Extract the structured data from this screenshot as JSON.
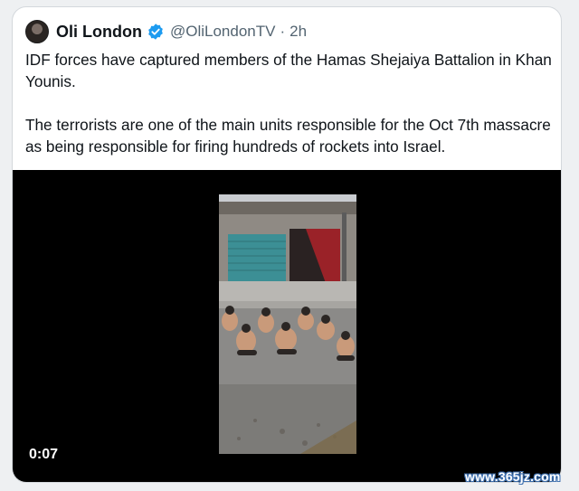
{
  "post": {
    "author_name": "Oli London",
    "handle": "@OliLondonTV",
    "separator": "·",
    "time": "2h",
    "paragraphs": [
      "IDF forces have captured members of the Hamas Shejaiya Battalion in Khan Younis.",
      "The terrorists are one of the main units responsible for the Oct 7th massacre as being responsible for firing hundreds of rockets into Israel."
    ],
    "verified_icon": "verified-badge-icon"
  },
  "video": {
    "duration": "0:07"
  },
  "watermark": "www.365jz.com",
  "colors": {
    "text_primary": "#0f1419",
    "text_secondary": "#536471",
    "verified_blue": "#1d9bf0",
    "media_background": "#000000"
  }
}
